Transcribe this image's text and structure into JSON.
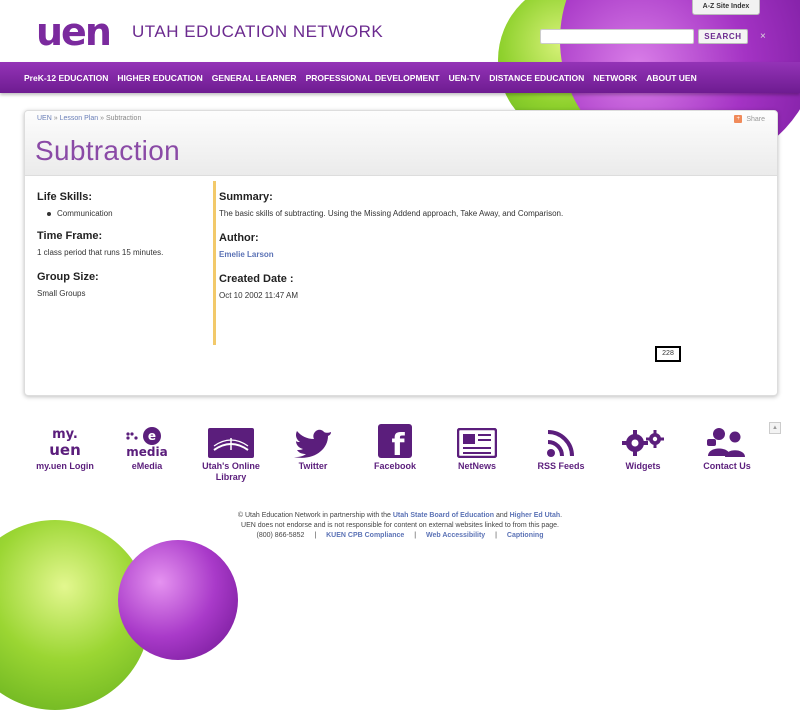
{
  "header": {
    "logo_text": "uen",
    "brand_name": "UTAH EDUCATION NETWORK",
    "az_link": "A-Z Site Index",
    "search": {
      "placeholder": "",
      "value": "",
      "button_label": "SEARCH"
    },
    "close_glyph": "×"
  },
  "nav": {
    "items": [
      "PreK-12 EDUCATION",
      "HIGHER EDUCATION",
      "GENERAL LEARNER",
      "PROFESSIONAL DEVELOPMENT",
      "UEN-TV",
      "DISTANCE EDUCATION",
      "NETWORK",
      "ABOUT UEN"
    ]
  },
  "breadcrumb": {
    "home": "UEN",
    "sep": "»",
    "section": "Lesson Plan",
    "current": "Subtraction"
  },
  "share_label": "Share",
  "page_title": "Subtraction",
  "sidebar": {
    "life_skills_heading": "Life Skills:",
    "life_skills_items": [
      "Communication"
    ],
    "time_frame_heading": "Time Frame:",
    "time_frame_text": "1 class period that runs 15 minutes.",
    "group_size_heading": "Group Size:",
    "group_size_text": "Small Groups"
  },
  "main": {
    "summary_heading": "Summary:",
    "summary_text": "The basic skills of subtracting. Using the Missing Addend approach, Take Away, and Comparison.",
    "author_heading": "Author:",
    "author_name": "Emelie Larson",
    "created_heading": "Created Date :",
    "created_date": "Oct 10 2002 11:47 AM"
  },
  "page_counter": "228",
  "scroll_top_glyph": "▲",
  "footer_links": [
    {
      "label": "my.uen Login",
      "icon": "my-uen-icon",
      "icon_text": "my.\nuen"
    },
    {
      "label": "eMedia",
      "icon": "emedia-icon",
      "icon_text": "emedia"
    },
    {
      "label": "Utah's Online Library",
      "icon": "library-icon"
    },
    {
      "label": "Twitter",
      "icon": "twitter-icon"
    },
    {
      "label": "Facebook",
      "icon": "facebook-icon",
      "icon_text": "f"
    },
    {
      "label": "NetNews",
      "icon": "netnews-icon"
    },
    {
      "label": "RSS Feeds",
      "icon": "rss-icon"
    },
    {
      "label": "Widgets",
      "icon": "widgets-icon"
    },
    {
      "label": "Contact Us",
      "icon": "contact-icon"
    }
  ],
  "legal": {
    "line1_prefix": "© Utah Education Network in partnership with the",
    "board_link": "Utah State Board of Education",
    "and": "and",
    "higher_ed_link": "Higher Ed Utah",
    "period": ".",
    "line2": "UEN does not endorse and is not responsible for content on external websites linked to from this page.",
    "phone": "(800) 866-5852",
    "divider": "|",
    "links": [
      "KUEN CPB Compliance",
      "Web Accessibility",
      "Captioning"
    ]
  },
  "colors": {
    "brand_purple": "#7b2a9e",
    "nav_purple": "#8a2eae",
    "title_purple": "#8a4aa6",
    "link_blue": "#5c73b6",
    "accent_gold": "#f2c96a"
  }
}
